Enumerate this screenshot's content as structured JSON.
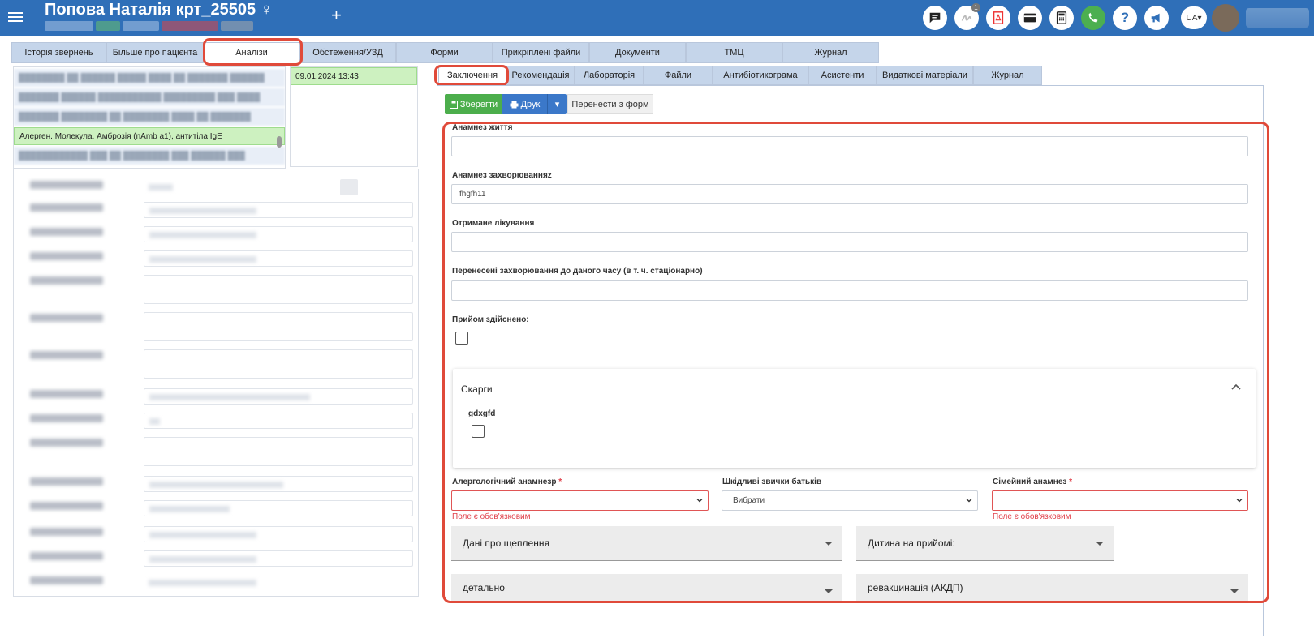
{
  "header": {
    "patient_name": "Попова Наталія крт_25505",
    "gender_symbol": "♀",
    "add_symbol": "+",
    "lang": "UA",
    "notification_count": "1",
    "icons": [
      "chat-icon",
      "signature-icon",
      "pdf-icon",
      "card-icon",
      "calculator-icon",
      "phone-icon",
      "help-icon",
      "megaphone-icon"
    ],
    "brand_color": "#2f6fb8"
  },
  "top_tabs": [
    {
      "label": "Історія звернень"
    },
    {
      "label": "Більше про пацієнта"
    },
    {
      "label": "Аналізи"
    },
    {
      "label": "Обстеження/УЗД"
    },
    {
      "label": "Форми"
    },
    {
      "label": "Прикріплені файли"
    },
    {
      "label": "Документи"
    },
    {
      "label": "ТМЦ"
    },
    {
      "label": "Журнал"
    }
  ],
  "left": {
    "selected_test": "Алерген. Молекула. Амброзія (nAmb a1), антитіла IgE",
    "date": "09.01.2024 13:43"
  },
  "sub_tabs": [
    {
      "label": "Заключення"
    },
    {
      "label": "Рекомендація"
    },
    {
      "label": "Лабораторія"
    },
    {
      "label": "Файли"
    },
    {
      "label": "Антибіотикограма"
    },
    {
      "label": "Асистенти"
    },
    {
      "label": "Видаткові матеріали"
    },
    {
      "label": "Журнал"
    }
  ],
  "toolbar": {
    "save": "Зберегти",
    "print": "Друк",
    "transfer": "Перенести з форм"
  },
  "form": {
    "life_anamnesis_label": "Анамнез життя",
    "life_anamnesis_value": "",
    "disease_anamnesis_label": "Анамнез захворюванняz",
    "disease_anamnesis_value": "fhgfh11",
    "treatment_label": "Отримане лікування",
    "treatment_value": "",
    "past_diseases_label": "Перенесені захворювання до даного часу (в т. ч. стаціонарно)",
    "past_diseases_value": "",
    "reception_label": "Прийом здійснено:",
    "complaints_title": "Скарги",
    "complaint_item": "gdxgfd",
    "allergy_label": "Алергологічний анамнезр",
    "habits_label": "Шкідливі звички батьків",
    "habits_value": "Вибрати",
    "family_label": "Сімейний анамнез",
    "required_mark": "*",
    "required_error": "Поле є обов'язковим",
    "vaccination_select": "Дані про щеплення",
    "child_select": "Дитина на прийомі:",
    "detail_select": "детально",
    "revaccination_select": "ревакцинація (АКДП)"
  },
  "colors": {
    "highlight": "#e04a3a",
    "save_button": "#4cae4c",
    "print_button": "#3b78c9",
    "selected_row": "#cdf1c0",
    "error": "#e0404a"
  }
}
